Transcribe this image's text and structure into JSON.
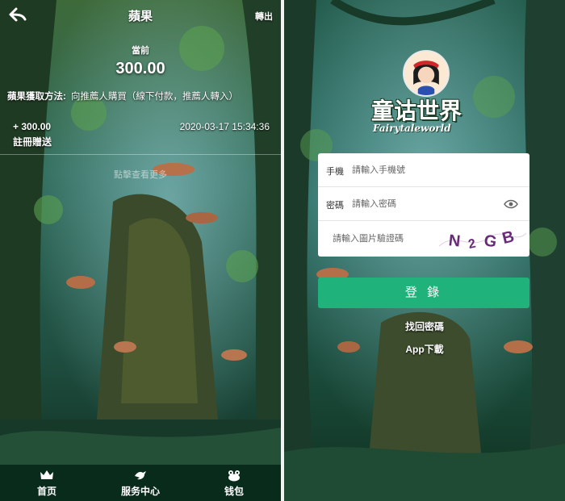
{
  "left": {
    "header": {
      "title": "蘋果",
      "transfer_label": "轉出",
      "back_icon": "back-arrow-icon"
    },
    "balance": {
      "label": "當前",
      "value": "300.00"
    },
    "method": {
      "label": "蘋果獲取方法:",
      "text": "向推薦人購買（線下付款，推薦人轉入）"
    },
    "records": [
      {
        "amount": "+ 300.00",
        "time": "2020-03-17 15:34:36",
        "desc": "註冊贈送"
      }
    ],
    "more_label": "點擊查看更多",
    "tabs": [
      {
        "label": "首页",
        "icon": "crown-icon"
      },
      {
        "label": "服务中心",
        "icon": "bird-icon"
      },
      {
        "label": "钱包",
        "icon": "frog-icon"
      }
    ]
  },
  "right": {
    "logo": {
      "title": "童诂世界",
      "subtitle": "Fairytaleworld"
    },
    "form": {
      "phone": {
        "label": "手機",
        "placeholder": "請輸入手機號"
      },
      "password": {
        "label": "密碼",
        "placeholder": "請輸入密碼"
      },
      "captcha": {
        "placeholder": "請輸入圖片驗證碼",
        "code": "N2GB"
      }
    },
    "login_label": "登 錄",
    "forgot_label": "找回密碼",
    "download_label": "App下載"
  },
  "colors": {
    "accent": "#1fb27a",
    "tabbar": "#08281a"
  }
}
